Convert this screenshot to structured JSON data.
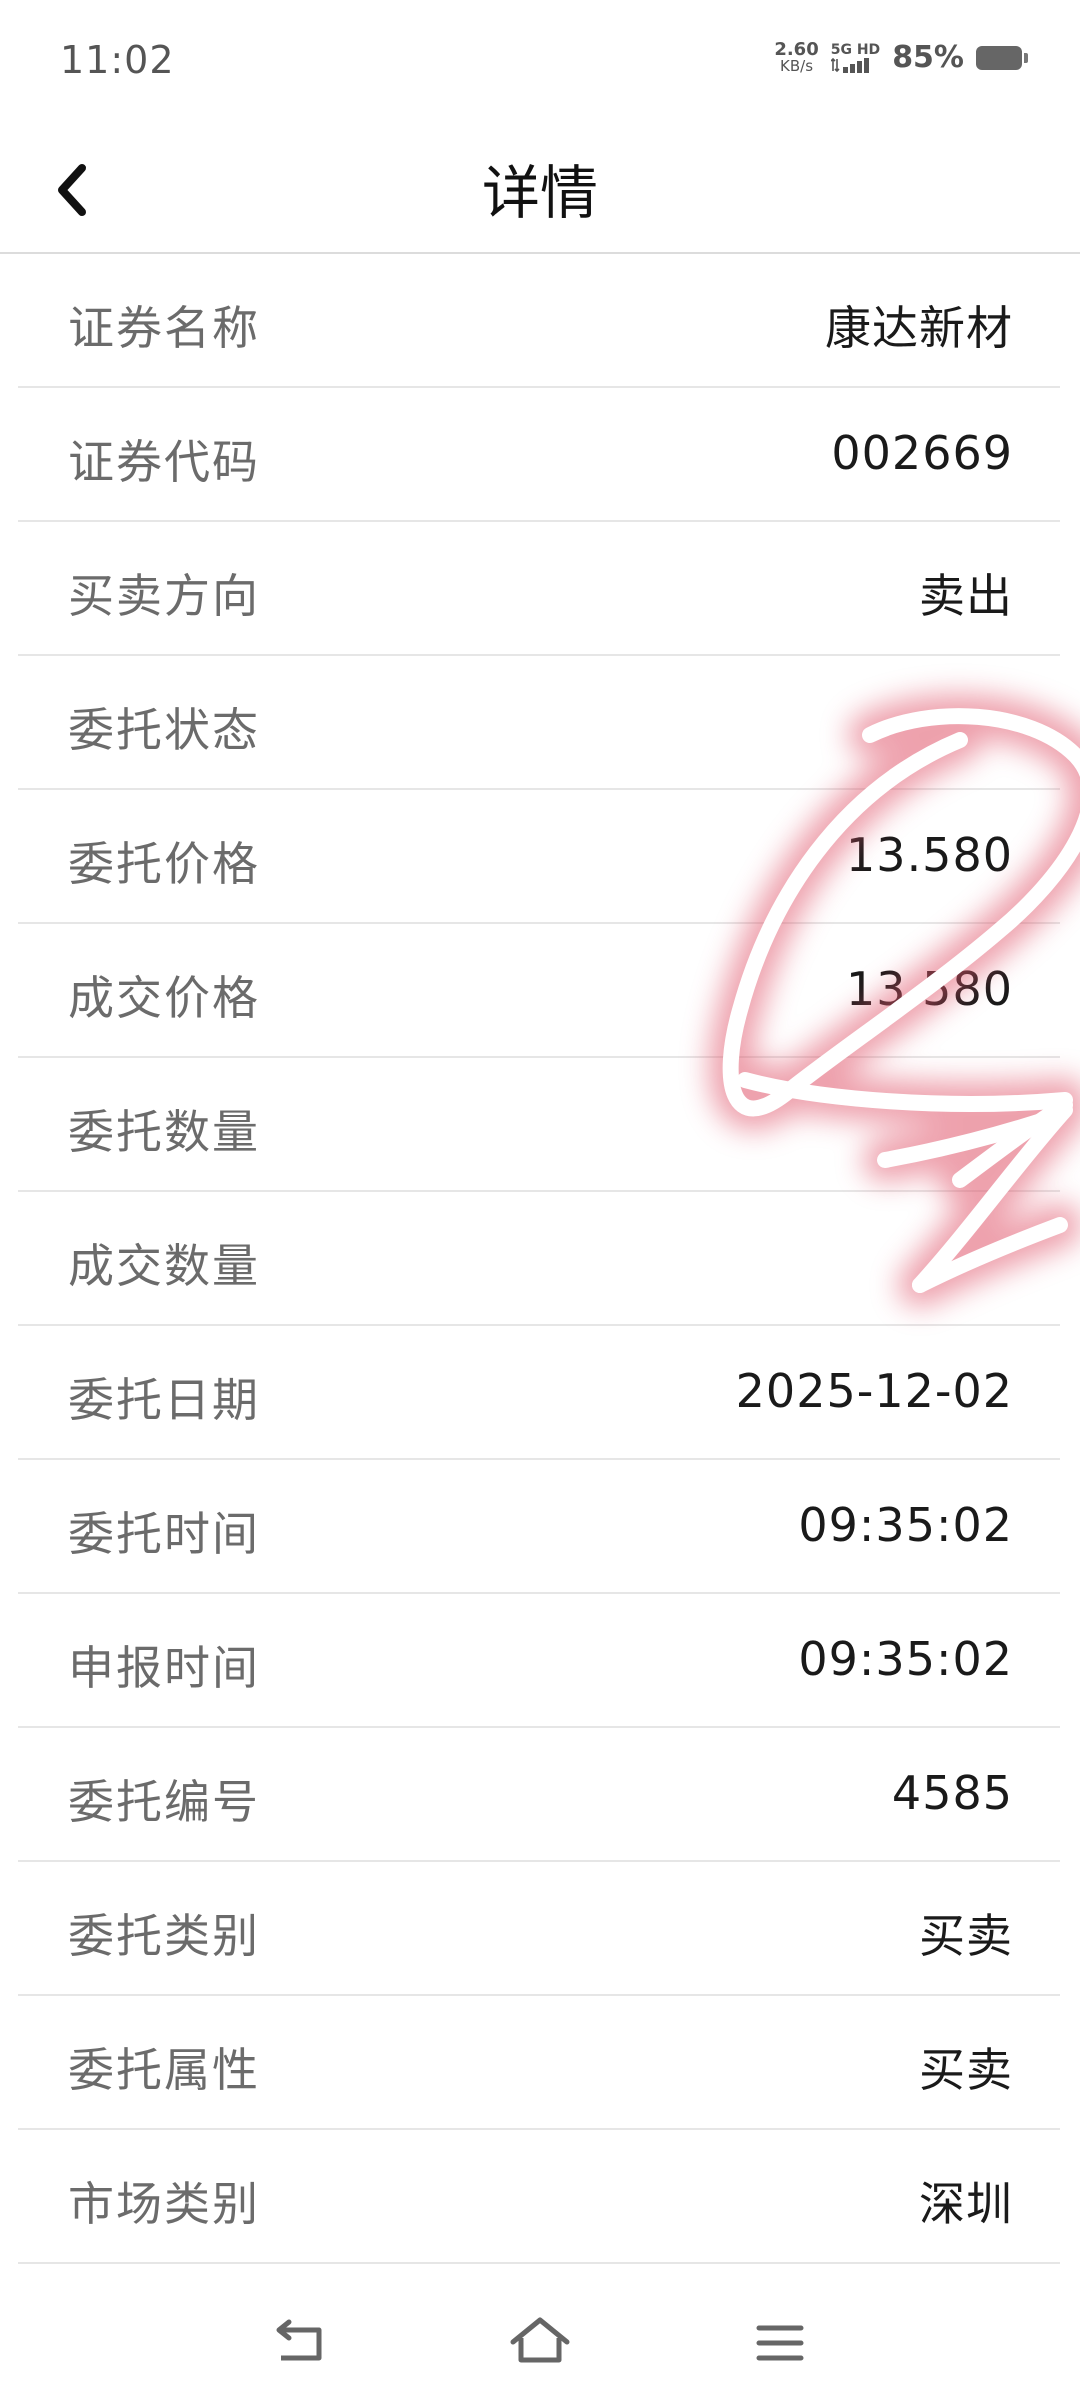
{
  "status_bar": {
    "time": "11:02",
    "net_speed": "2.60",
    "net_speed_unit": "KB/s",
    "signal_label": "5G HD",
    "battery_percent": "85%"
  },
  "header": {
    "title": "详情",
    "back_icon": "chevron-left-icon"
  },
  "details": [
    {
      "label": "证券名称",
      "value": "康达新材"
    },
    {
      "label": "证券代码",
      "value": "002669"
    },
    {
      "label": "买卖方向",
      "value": "卖出"
    },
    {
      "label": "委托状态",
      "value": ""
    },
    {
      "label": "委托价格",
      "value": "13.580"
    },
    {
      "label": "成交价格",
      "value": "13.580"
    },
    {
      "label": "委托数量",
      "value": ""
    },
    {
      "label": "成交数量",
      "value": ""
    },
    {
      "label": "委托日期",
      "value": "2025-12-02"
    },
    {
      "label": "委托时间",
      "value": "09:35:02"
    },
    {
      "label": "申报时间",
      "value": "09:35:02"
    },
    {
      "label": "委托编号",
      "value": "4585"
    },
    {
      "label": "委托类别",
      "value": "买卖"
    },
    {
      "label": "委托属性",
      "value": "买卖"
    },
    {
      "label": "市场类别",
      "value": "深圳"
    }
  ],
  "annotation": {
    "color": "#d93a4f",
    "shape": "circle-and-arrow"
  },
  "nav_bar": {
    "icons": [
      "back-icon",
      "home-icon",
      "menu-icon"
    ]
  }
}
